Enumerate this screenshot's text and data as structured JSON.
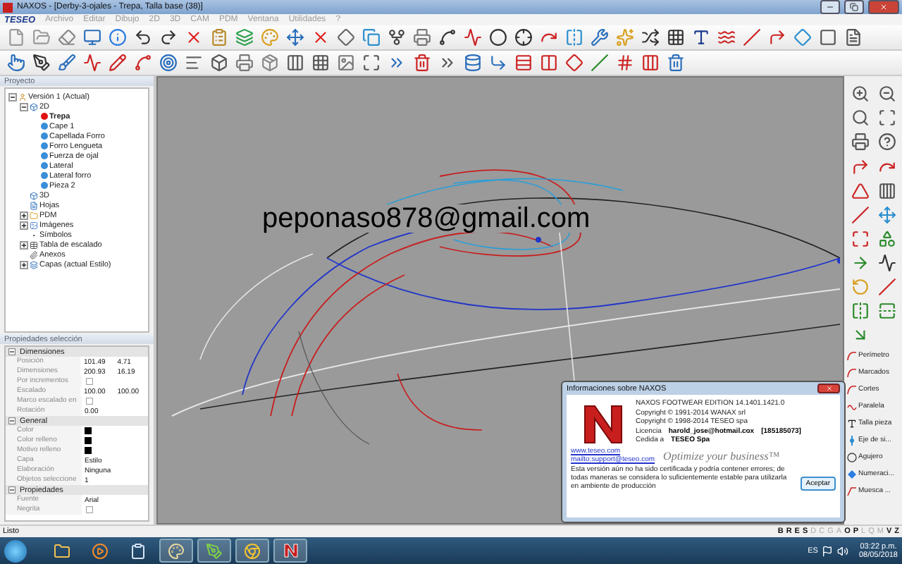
{
  "window": {
    "title": "NAXOS - [Derby-3-ojales - Trepa, Talla base (38)]"
  },
  "menu": {
    "logo": "TESEO",
    "items": [
      "Archivo",
      "Editar",
      "Dibujo",
      "2D",
      "3D",
      "CAM",
      "PDM",
      "Ventana",
      "Utilidades",
      "?"
    ]
  },
  "project_panel": {
    "title": "Proyecto",
    "tree": [
      {
        "label": "Versión 1 (Actual)",
        "kind": "version",
        "expanded": true,
        "selected": false,
        "children": [
          {
            "label": "2D",
            "kind": "model",
            "expanded": true,
            "selected": false,
            "children": [
              {
                "label": "Trepa",
                "kind": "piece",
                "selected": true
              },
              {
                "label": "Cape 1",
                "kind": "piece",
                "selected": false
              },
              {
                "label": "Capellada Forro",
                "kind": "piece",
                "selected": false
              },
              {
                "label": "Forro Lengueta",
                "kind": "piece",
                "selected": false
              },
              {
                "label": "Fuerza de ojal",
                "kind": "piece",
                "selected": false
              },
              {
                "label": "Lateral",
                "kind": "piece",
                "selected": false
              },
              {
                "label": "Lateral forro",
                "kind": "piece",
                "selected": false
              },
              {
                "label": "Pieza 2",
                "kind": "piece",
                "selected": false
              }
            ]
          },
          {
            "label": "3D",
            "kind": "model",
            "selected": false
          },
          {
            "label": "Hojas",
            "kind": "sheet",
            "selected": false
          },
          {
            "label": "PDM",
            "kind": "folder",
            "expanded": false,
            "selected": false
          },
          {
            "label": "Imágenes",
            "kind": "image",
            "expanded": false,
            "selected": false
          },
          {
            "label": "Símbolos",
            "kind": "symbol",
            "selected": false
          },
          {
            "label": "Tabla de escalado",
            "kind": "table",
            "expanded": false,
            "selected": false
          },
          {
            "label": "Anexos",
            "kind": "clip",
            "selected": false
          },
          {
            "label": "Capas (actual Estilo)",
            "kind": "layers",
            "expanded": false,
            "selected": false
          }
        ]
      }
    ]
  },
  "properties_panel": {
    "title": "Propiedades selección",
    "sections": [
      {
        "title": "Dimensiones",
        "expanded": true,
        "rows": [
          {
            "kind": "text",
            "label": "Posición",
            "values": [
              "101.49",
              "4.71"
            ]
          },
          {
            "kind": "text",
            "label": "Dimensiones",
            "values": [
              "200.93",
              "16.19"
            ]
          },
          {
            "kind": "check",
            "label": "Por incrementos",
            "checked": false
          },
          {
            "kind": "text",
            "label": "Escalado",
            "values": [
              "100.00",
              "100.00"
            ]
          },
          {
            "kind": "check",
            "label": "Marco escalado en",
            "checked": false
          },
          {
            "kind": "text",
            "label": "Rotación",
            "values": [
              "0.00"
            ]
          }
        ]
      },
      {
        "title": "General",
        "expanded": true,
        "rows": [
          {
            "kind": "swatch",
            "label": "Color",
            "color": "#000000"
          },
          {
            "kind": "swatch",
            "label": "Color relleno",
            "color": "#000000"
          },
          {
            "kind": "swatch",
            "label": "Motivo relleno",
            "color": "#000000"
          },
          {
            "kind": "text",
            "label": "Capa",
            "values": [
              "Estilo"
            ]
          },
          {
            "kind": "text",
            "label": "Elaboración",
            "values": [
              "Ninguna"
            ]
          },
          {
            "kind": "text",
            "label": "Objetos seleccione",
            "values": [
              "1"
            ]
          }
        ]
      },
      {
        "title": "Propiedades",
        "expanded": true,
        "rows": [
          {
            "kind": "text",
            "label": "Fuente",
            "values": [
              "Arial"
            ]
          },
          {
            "kind": "check",
            "label": "Negrita",
            "checked": false
          }
        ]
      }
    ]
  },
  "canvas": {
    "overlay_text": "peponaso878@gmail.com"
  },
  "right_tools": [
    {
      "label": "Perímetro",
      "kind": "curve"
    },
    {
      "label": "Marcados",
      "kind": "curve"
    },
    {
      "label": "Cortes",
      "kind": "curve"
    },
    {
      "label": "Paralela",
      "kind": "wave"
    },
    {
      "label": "Talla pieza",
      "kind": "text"
    },
    {
      "label": "Eje de si...",
      "kind": "axis"
    },
    {
      "label": "Agujero",
      "kind": "circle"
    },
    {
      "label": "Numeraci...",
      "kind": "diamond"
    },
    {
      "label": "Muesca ...",
      "kind": "notch"
    }
  ],
  "dialog": {
    "title": "Informaciones sobre  NAXOS",
    "product": "NAXOS FOOTWEAR EDITION 14.1401.1421.0",
    "copyrights": [
      "Copyright © 1991-2014 WANAX srl",
      "Copyright © 1998-2014 TESEO spa"
    ],
    "license": {
      "label": "Licencia",
      "value": "harold_jose@hotmail.cox",
      "code": "[185185073]"
    },
    "assignee": {
      "label": "Cedida a",
      "value": "TESEO Spa"
    },
    "links": [
      "www.teseo.com",
      "mailto:support@teseo.com"
    ],
    "slogan": "Optimize your business™",
    "notice": "Esta versión aún no ha sido certificada y podría contener errores; de todas maneras se considera lo suficientemente estable para utilizarla en ambiente de producción",
    "button": "Aceptar"
  },
  "status_bar": {
    "text": "Listo",
    "letters": [
      {
        "label": "B",
        "on": true
      },
      {
        "label": "R",
        "on": true
      },
      {
        "label": "E",
        "on": true
      },
      {
        "label": "S",
        "on": true
      },
      {
        "label": "D",
        "on": false
      },
      {
        "label": "C",
        "on": false
      },
      {
        "label": "G",
        "on": false
      },
      {
        "label": "A",
        "on": false
      },
      {
        "label": "O",
        "on": true
      },
      {
        "label": "P",
        "on": true
      },
      {
        "label": "L",
        "on": false
      },
      {
        "label": "Q",
        "on": false
      },
      {
        "label": "M",
        "on": false
      },
      {
        "label": "V",
        "on": true
      },
      {
        "label": "Z",
        "on": true
      }
    ]
  },
  "taskbar": {
    "apps": [
      {
        "kind": "folder",
        "running": false
      },
      {
        "kind": "media",
        "running": false
      },
      {
        "kind": "notepad",
        "running": false
      },
      {
        "kind": "paint",
        "running": true
      },
      {
        "kind": "drawing",
        "running": true
      },
      {
        "kind": "browser",
        "running": true
      },
      {
        "kind": "naxos",
        "running": true
      }
    ],
    "language": "ES",
    "time": "03:22 p.m.",
    "date": "08/05/2018"
  }
}
